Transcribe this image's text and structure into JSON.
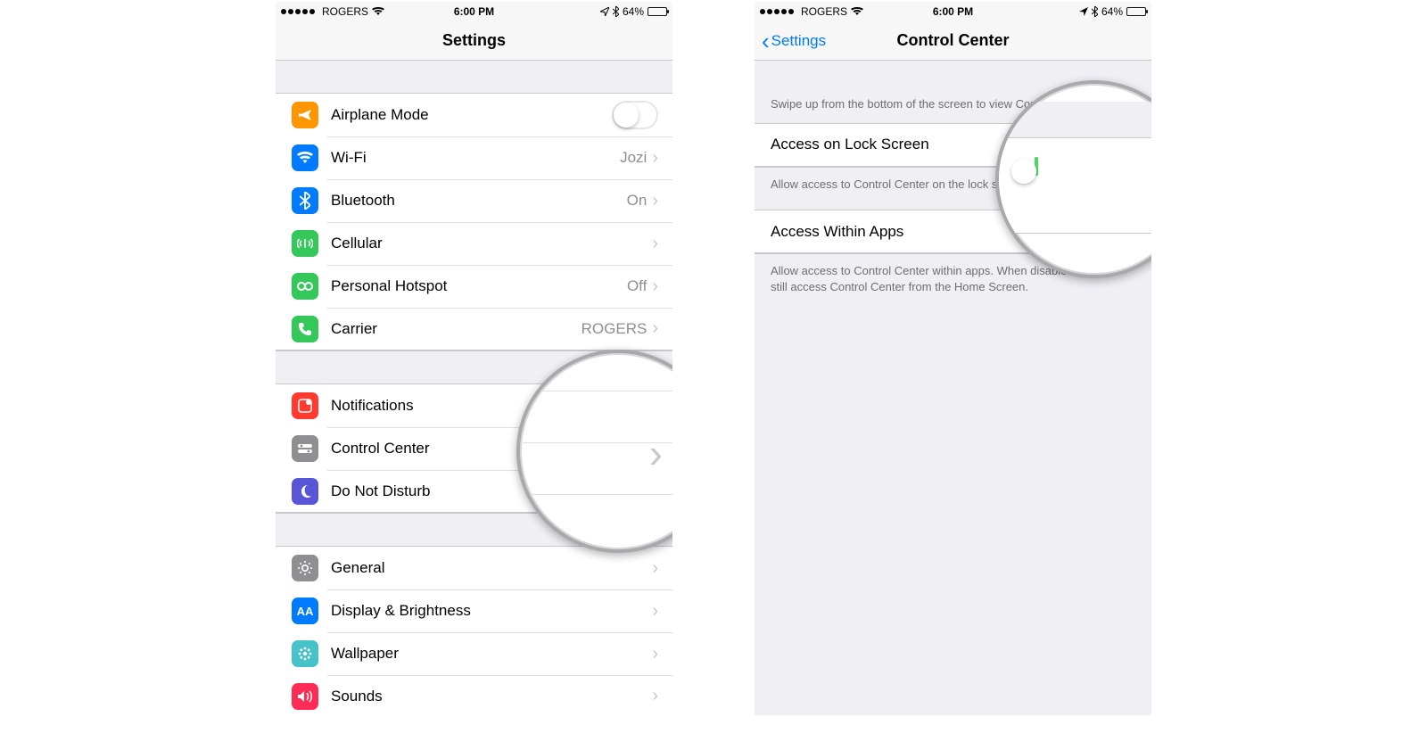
{
  "status_bar": {
    "carrier": "ROGERS",
    "time": "6:00 PM",
    "battery_pct": "64%"
  },
  "left": {
    "title": "Settings",
    "groups": [
      [
        {
          "icon": "airplane",
          "label": "Airplane Mode",
          "detail": "",
          "accessory": "switch_off",
          "color": "bg-orange"
        },
        {
          "icon": "wifi",
          "label": "Wi-Fi",
          "detail": "Jozi",
          "accessory": "disclosure",
          "color": "bg-blue"
        },
        {
          "icon": "bt",
          "label": "Bluetooth",
          "detail": "On",
          "accessory": "disclosure",
          "color": "bg-blue"
        },
        {
          "icon": "cell",
          "label": "Cellular",
          "detail": "",
          "accessory": "disclosure",
          "color": "bg-green"
        },
        {
          "icon": "hotspot",
          "label": "Personal Hotspot",
          "detail": "Off",
          "accessory": "disclosure",
          "color": "bg-green"
        },
        {
          "icon": "phone",
          "label": "Carrier",
          "detail": "ROGERS",
          "accessory": "disclosure",
          "color": "bg-green"
        }
      ],
      [
        {
          "icon": "notif",
          "label": "Notifications",
          "detail": "",
          "accessory": "disclosure",
          "color": "bg-red"
        },
        {
          "icon": "cc",
          "label": "Control Center",
          "detail": "",
          "accessory": "disclosure",
          "color": "bg-gray"
        },
        {
          "icon": "dnd",
          "label": "Do Not Disturb",
          "detail": "",
          "accessory": "disclosure",
          "color": "bg-purple"
        }
      ],
      [
        {
          "icon": "gear",
          "label": "General",
          "detail": "",
          "accessory": "disclosure",
          "color": "bg-gray"
        },
        {
          "icon": "aa",
          "label": "Display & Brightness",
          "detail": "",
          "accessory": "disclosure",
          "color": "bg-blue"
        },
        {
          "icon": "flower",
          "label": "Wallpaper",
          "detail": "",
          "accessory": "disclosure",
          "color": "bg-teal"
        },
        {
          "icon": "sound",
          "label": "Sounds",
          "detail": "",
          "accessory": "disclosure",
          "color": "bg-pink"
        }
      ]
    ]
  },
  "right": {
    "back_label": "Settings",
    "title": "Control Center",
    "header_text": "Swipe up from the bottom of the screen to view Control Center.",
    "rows": [
      {
        "label": "Access on Lock Screen",
        "accessory": "switch_on",
        "footer": "Allow access to Control Center on the lock screen."
      },
      {
        "label": "Access Within Apps",
        "accessory": "switch_on",
        "footer": "Allow access to Control Center within apps. When disabled, you can still access Control Center from the Home Screen."
      }
    ]
  }
}
